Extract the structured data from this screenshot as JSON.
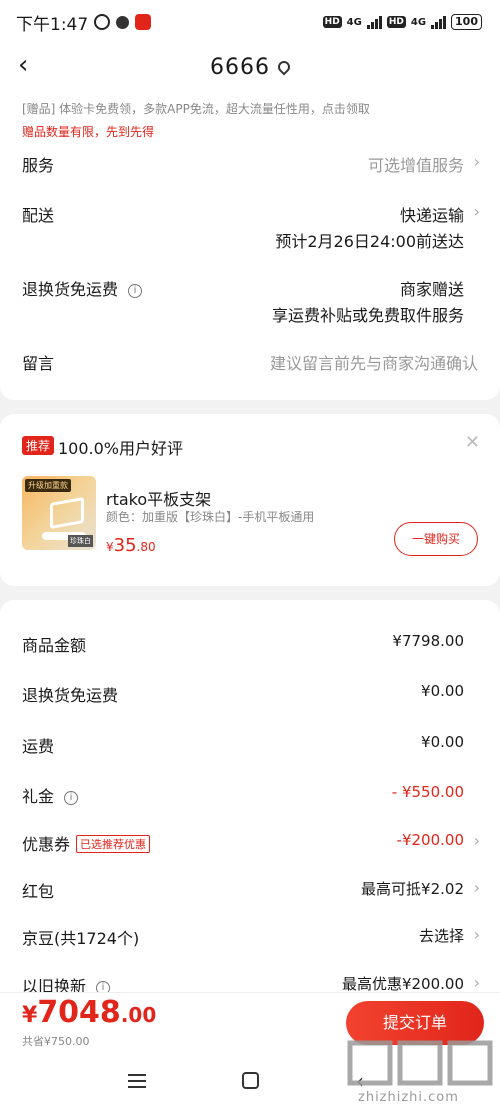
{
  "status_bar": {
    "time": "下午1:47",
    "network1": "4G",
    "network2": "4G",
    "battery": "100"
  },
  "header": {
    "title": "6666"
  },
  "gift": {
    "line": "[赠品]  体验卡免费领，多款APP免流，超大流量任性用，点击领取",
    "warn": "赠品数量有限，先到先得"
  },
  "service": {
    "label": "服务",
    "value": "可选增值服务"
  },
  "delivery": {
    "label": "配送",
    "value": "快递运输",
    "sub": "预计2月26日24:00前送达"
  },
  "return_fee": {
    "label": "退换货免运费",
    "value": "商家赠送",
    "sub": "享运费补贴或免费取件服务"
  },
  "message": {
    "label": "留言",
    "placeholder": "建议留言前先与商家沟通确认"
  },
  "recommend": {
    "tag": "推荐",
    "title": "100.0%用户好评",
    "thumb_tag": "升级加重款",
    "thumb_foot": "珍珠白",
    "product_name": "rtako平板支架",
    "product_spec": "颜色：加重版【珍珠白】-手机平板通用",
    "price_symbol": "¥",
    "price_int": "35",
    "price_dec": ".80",
    "buy_label": "一键购买"
  },
  "amounts": {
    "goods_label": "商品金额",
    "goods_value": "¥7798.00",
    "return_label": "退换货免运费",
    "return_value": "¥0.00",
    "shipping_label": "运费",
    "shipping_value": "¥0.00",
    "gift_label": "礼金",
    "gift_value": "- ¥550.00",
    "coupon_label": "优惠券",
    "coupon_badge": "已选推荐优惠",
    "coupon_value": "-¥200.00",
    "redpack_label": "红包",
    "redpack_value": "最高可抵¥2.02",
    "jd_label": "京豆(共1724个)",
    "jd_value": "去选择",
    "tradein_label": "以旧换新",
    "tradein_value": "最高优惠¥200.00"
  },
  "bottom": {
    "currency": "¥",
    "total_int": "7048",
    "total_dec": ".00",
    "saved": "共省¥750.00",
    "submit_label": "提交订单"
  },
  "watermark": {
    "text": "zhizhizhi.com",
    "glyph": "值值值"
  },
  "colors": {
    "accent": "#e1251b",
    "background": "#f2f2f2"
  }
}
